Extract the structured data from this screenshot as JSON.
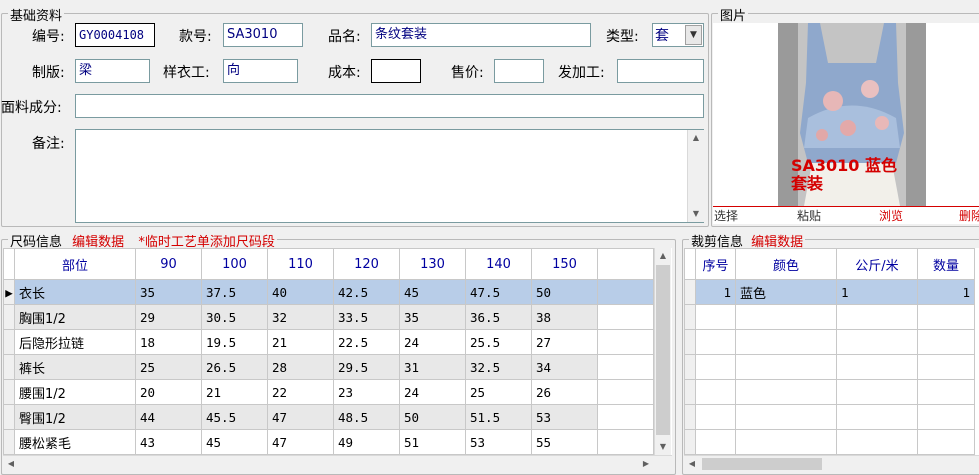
{
  "basic": {
    "title": "基础资料",
    "fields": {
      "code_label": "编号:",
      "code_value": "GY0004108",
      "style_label": "款号:",
      "style_value": "SA3010",
      "name_label": "品名:",
      "name_value": "条纹套装",
      "type_label": "类型:",
      "type_value": "套",
      "plate_label": "制版:",
      "plate_value": "梁",
      "sample_label": "样衣工:",
      "sample_value": "向",
      "cost_label": "成本:",
      "cost_value": "",
      "price_label": "售价:",
      "price_value": "",
      "process_label": "发加工:",
      "process_value": "",
      "fabric_label": "面料成分:",
      "fabric_value": "",
      "remark_label": "备注:",
      "remark_value": ""
    }
  },
  "photo": {
    "title": "图片",
    "caption": "SA3010  蓝色 套装",
    "actions": [
      "选择",
      "粘贴",
      "浏览",
      "删除"
    ]
  },
  "size": {
    "title": "尺码信息",
    "edit_link": "编辑数据",
    "note": "*临时工艺单添加尺码段",
    "headers": [
      "部位",
      "90",
      "100",
      "110",
      "120",
      "130",
      "140",
      "150"
    ],
    "rows": [
      [
        "衣长",
        "35",
        "37.5",
        "40",
        "42.5",
        "45",
        "47.5",
        "50"
      ],
      [
        "胸围1/2",
        "29",
        "30.5",
        "32",
        "33.5",
        "35",
        "36.5",
        "38"
      ],
      [
        "后隐形拉链",
        "18",
        "19.5",
        "21",
        "22.5",
        "24",
        "25.5",
        "27"
      ],
      [
        "裤长",
        "25",
        "26.5",
        "28",
        "29.5",
        "31",
        "32.5",
        "34"
      ],
      [
        "腰围1/2",
        "20",
        "21",
        "22",
        "23",
        "24",
        "25",
        "26"
      ],
      [
        "臀围1/2",
        "44",
        "45.5",
        "47",
        "48.5",
        "50",
        "51.5",
        "53"
      ],
      [
        "腰松紧毛",
        "43",
        "45",
        "47",
        "49",
        "51",
        "53",
        "55"
      ]
    ]
  },
  "cut": {
    "title": "裁剪信息",
    "edit_link": "编辑数据",
    "headers": [
      "序号",
      "颜色",
      "公斤/米",
      "数量"
    ],
    "rows": [
      [
        "1",
        "蓝色",
        "1",
        "1"
      ]
    ]
  }
}
